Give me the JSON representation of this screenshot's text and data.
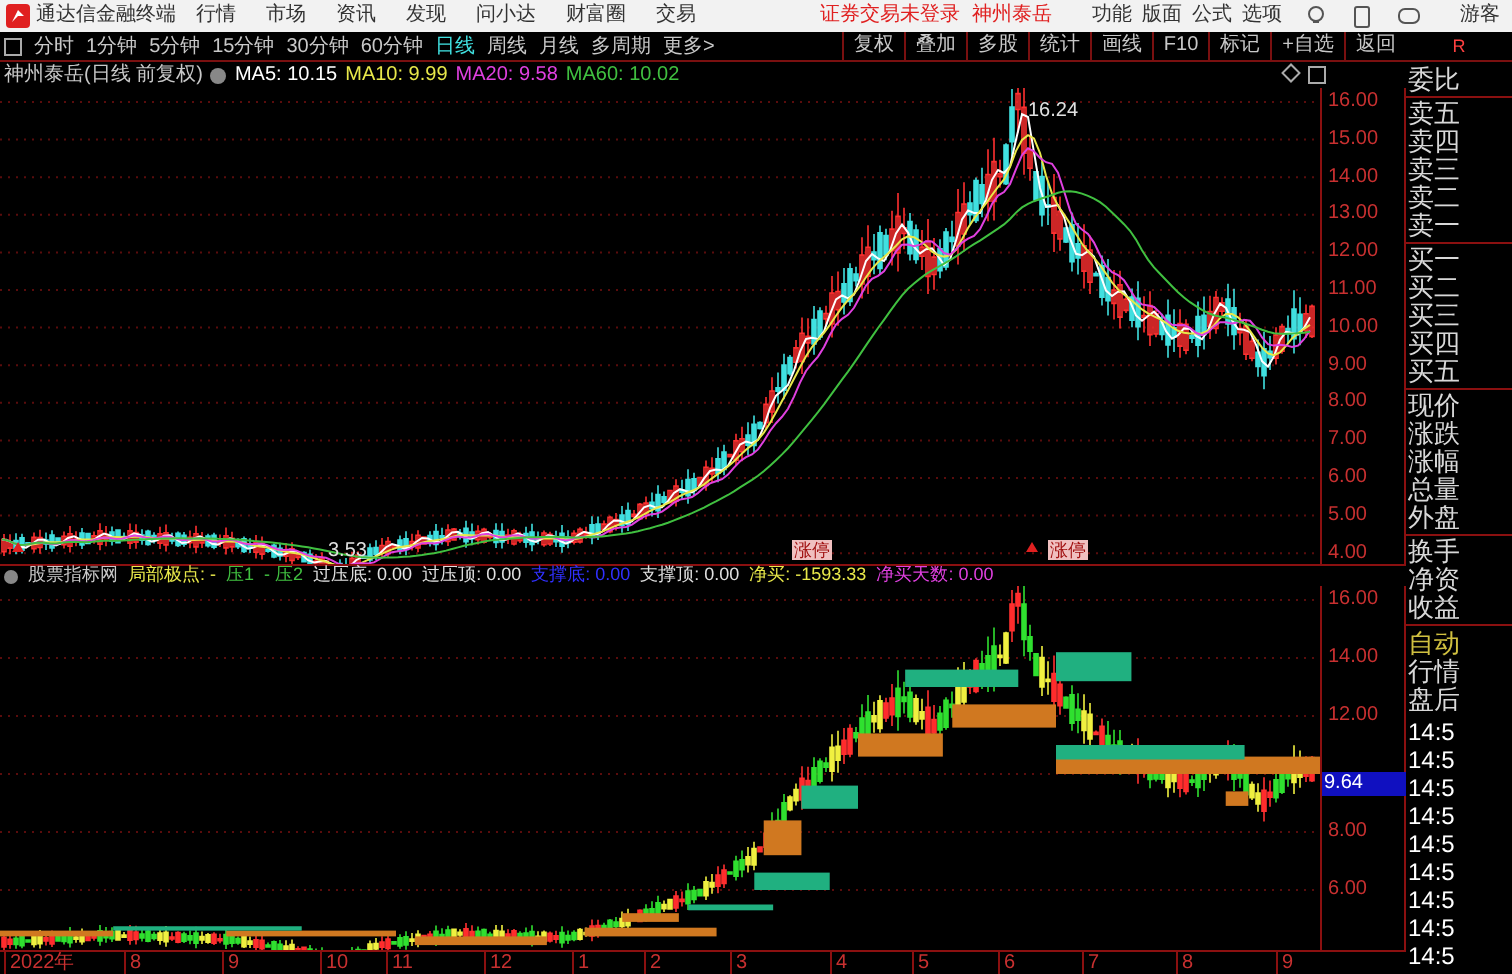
{
  "menu_bar": {
    "app_title": "通达信金融终端",
    "menus": [
      "行情",
      "市场",
      "资讯",
      "发现",
      "问小达",
      "财富圈",
      "交易"
    ],
    "login_status": "证券交易未登录",
    "stock_name": "神州泰岳",
    "tools": [
      "功能",
      "版面",
      "公式",
      "选项"
    ],
    "user": "游客"
  },
  "period_tabs": [
    {
      "label": "分时",
      "selected": false
    },
    {
      "label": "1分钟",
      "selected": false
    },
    {
      "label": "5分钟",
      "selected": false
    },
    {
      "label": "15分钟",
      "selected": false
    },
    {
      "label": "30分钟",
      "selected": false
    },
    {
      "label": "60分钟",
      "selected": false
    },
    {
      "label": "日线",
      "selected": true
    },
    {
      "label": "周线",
      "selected": false
    },
    {
      "label": "月线",
      "selected": false
    },
    {
      "label": "多周期",
      "selected": false
    },
    {
      "label": "更多>",
      "selected": false
    }
  ],
  "toolbar_buttons": [
    "复权",
    "叠加",
    "多股",
    "统计",
    "画线",
    "F10",
    "标记",
    "+自选",
    "返回"
  ],
  "corner_label": "R",
  "chart_title": {
    "name": "神州泰岳(日线 前复权)",
    "ma": [
      {
        "label": "MA5: 10.15",
        "color": "#ffffff"
      },
      {
        "label": "MA10: 9.99",
        "color": "#e8e84a"
      },
      {
        "label": "MA20: 9.58",
        "color": "#e040e0"
      },
      {
        "label": "MA60: 10.02",
        "color": "#40c040"
      }
    ]
  },
  "price_axis": [
    "16.00",
    "15.00",
    "14.00",
    "13.00",
    "12.00",
    "11.00",
    "10.00",
    "9.00",
    "8.00",
    "7.00",
    "6.00",
    "5.00",
    "4.00"
  ],
  "annotations": {
    "high": "16.24",
    "low": "3.53",
    "limit_up": [
      "涨停",
      "涨停"
    ]
  },
  "indicator": {
    "name": "股票指标网",
    "items": [
      {
        "text": "局部极点: -",
        "color": "#e8e84a"
      },
      {
        "text": "压1",
        "color": "#40c040"
      },
      {
        "text": "- 压2",
        "color": "#40c040"
      },
      {
        "text": "过压底: 0.00",
        "color": "#e0e0e0"
      },
      {
        "text": "过压顶: 0.00",
        "color": "#e0e0e0"
      },
      {
        "text": "支撑底: 0.00",
        "color": "#3030ff"
      },
      {
        "text": "支撑顶: 0.00",
        "color": "#e0e0e0"
      },
      {
        "text": "净买: -1593.33",
        "color": "#e8e84a"
      },
      {
        "text": "净买天数: 0.00",
        "color": "#e040e0"
      }
    ]
  },
  "indicator_axis": [
    "16.00",
    "14.00",
    "12.00",
    "8.00",
    "6.00"
  ],
  "indicator_value": "9.64",
  "date_axis": [
    "2022年",
    "8",
    "9",
    "10",
    "11",
    "12",
    "1",
    "2",
    "3",
    "4",
    "5",
    "6",
    "7",
    "8",
    "9"
  ],
  "side_panel": {
    "quote_labels": [
      "委比",
      "卖五",
      "卖四",
      "卖三",
      "卖二",
      "卖一",
      "买一",
      "买二",
      "买三",
      "买四",
      "买五",
      "现价",
      "涨跌",
      "涨幅",
      "总量",
      "外盘",
      "换手",
      "净资",
      "收益"
    ],
    "mode_labels": [
      "自动",
      "行情",
      "盘后"
    ],
    "times": [
      "14:5",
      "14:5",
      "14:5",
      "14:5",
      "14:5",
      "14:5",
      "14:5",
      "14:5",
      "14:5"
    ]
  }
}
